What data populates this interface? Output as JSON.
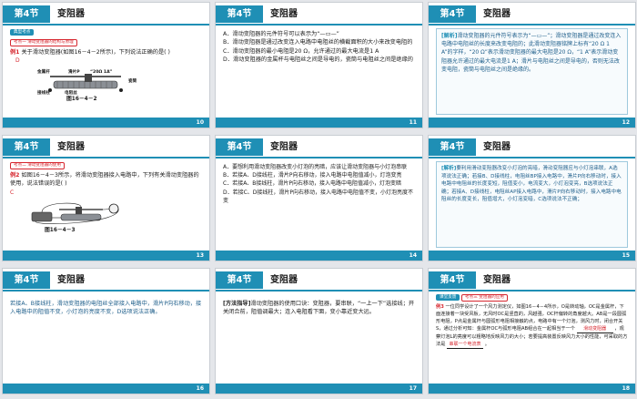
{
  "section_tag": "第4节",
  "section_title": "变阻器",
  "slides": [
    {
      "page": "10",
      "module": "典型考点",
      "subsection": "考点一 滑动变阻器的结构与原理",
      "example_label": "例1",
      "question": "关于滑动变阻器(如图16－4－2所示)，下列说法正确的是(    )",
      "answer": "D",
      "figure_labels": [
        "金属杆",
        "滑片P",
        "“20Ω 1A”",
        "接线柱",
        "电阻丝",
        "瓷筒"
      ],
      "figure_caption": "图16－4－2"
    },
    {
      "page": "11",
      "options": [
        "A．滑动变阻器的元件符号可以表示为“—▭—”",
        "B．滑动变阻器是通过改变连入电路中电阻丝的横截面积的大小来改变电阻的",
        "C．滑动变阻器的最小电阻是20 Ω，允许通过的最大电流是1 A",
        "D．滑动变阻器的金属杆与电阻丝之间是导电的，瓷筒与电阻丝之间是绝缘的"
      ]
    },
    {
      "page": "12",
      "label": "[解析]",
      "text": "滑动变阻器的元件符号表示为“—▭—”；滑动变阻器是通过改变连入电路中电阻丝的长度来改变电阻的；此滑动变阻器铭牌上标有“20 Ω 1 A”的字样，“20 Ω”表示滑动变阻器的最大电阻是20 Ω，“1 A”表示滑动变阻器允许通过的最大电流是1 A；滑片与电阻丝之间是导电的，否则无法改变电阻，瓷筒与电阻丝之间是绝缘的。"
    },
    {
      "page": "13",
      "subsection": "考点二 滑动变阻器的使用",
      "example_label": "例2",
      "question": "如图16－4－3所示，将滑动变阻器接入电路中，下列有关滑动变阻器的使用，说法错误的是(    )",
      "answer": "C",
      "figure_caption": "图16－4－3"
    },
    {
      "page": "14",
      "options": [
        "A．要想利用滑动变阻器改变小灯泡的亮暗，应该让滑动变阻器与小灯泡串联",
        "B．若接A、D接线柱，滑片P向右移动，接入电路中电阻值减小，灯泡变亮",
        "C．若接A、B接线柱，滑片P向右移动，接入电路中电阻值减小，灯泡变暗",
        "D．若接C、D接线柱，滑片P向右移动，接入电路中电阻值不变，小灯泡亮度不变"
      ]
    },
    {
      "page": "15",
      "label": "[解析]",
      "text": "要利用滑动变阻器改变小灯泡的亮暗，滑动变阻器应与小灯泡串联，A选项说法正确；若接B、D接线柱，电阻丝BP接入电路中，滑片P向右移动时，接入电路中电阻丝的长度变短，阻值变小，电流变大，小灯泡变亮，B选项说法正确；若接A、D接线柱，电阻丝AP接入电路中，滑片P向右移动时，接入电路中电阻丝的长度变长，阻值增大，小灯泡变暗，C选项说法不正确；"
    },
    {
      "page": "16",
      "text": "若接A、B接线柱，滑动变阻器的电阻丝全部接入电路中，滑片P向右移动，接入电路中的阻值不变，小灯泡的亮度不变，D选项说法正确。"
    },
    {
      "page": "17",
      "method_label": "[方法指导]",
      "text": "滑动变阻器的使用口诀：变阻器，要串联，“一上一下”选接线；开关闭合前，阻值调最大；连入电阻看下面，变小靠近变大远。"
    },
    {
      "page": "18",
      "module": "课堂反馈",
      "subsection": "考点三 变阻器的应用",
      "example_label": "例3",
      "question": "一位同学设计了一个风力测定仪，如图16－4－4所示，O是转动轴，OC是金属杆，下面连接着一块受风板，无风时OC是竖直的，风越强，OC杆偏转的角度越大。AB是一段圆弧形电阻，P点是金属杆与圆弧形电阻相接触的点，电路中有一个灯泡，测风力时，闭合开关S，通过分析可知：金属杆OC与弧形电阻AB组合在一起相当于一个",
      "blank1": "滑动变阻器",
      "question_mid": "，观察灯泡L的亮度可以粗略地反映风力的大小；若要提高装置反映风力大小的性能，可采取的方法是",
      "blank2": "串联一个电流表",
      "question_end": "。"
    }
  ]
}
